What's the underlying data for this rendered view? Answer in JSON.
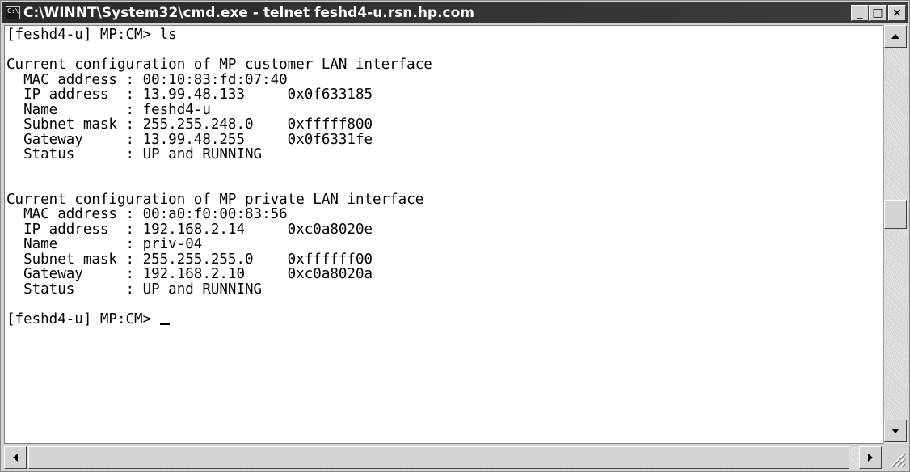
{
  "window": {
    "icon_label": "C:\\",
    "title": "C:\\WINNT\\System32\\cmd.exe - telnet feshd4-u.rsn.hp.com",
    "minimize_label": "_",
    "maximize_label": "□",
    "close_label": "×"
  },
  "console": {
    "lines": [
      "[feshd4-u] MP:CM> ls",
      "",
      "Current configuration of MP customer LAN interface",
      "  MAC address : 00:10:83:fd:07:40",
      "  IP address  : 13.99.48.133     0x0f633185",
      "  Name        : feshd4-u",
      "  Subnet mask : 255.255.248.0    0xfffff800",
      "  Gateway     : 13.99.48.255     0x0f6331fe",
      "  Status      : UP and RUNNING",
      "",
      "",
      "Current configuration of MP private LAN interface",
      "  MAC address : 00:a0:f0:00:83:56",
      "  IP address  : 192.168.2.14     0xc0a8020e",
      "  Name        : priv-04",
      "  Subnet mask : 255.255.255.0    0xffffff00",
      "  Gateway     : 192.168.2.10     0xc0a8020a",
      "  Status      : UP and RUNNING",
      ""
    ],
    "prompt": "[feshd4-u] MP:CM> "
  }
}
